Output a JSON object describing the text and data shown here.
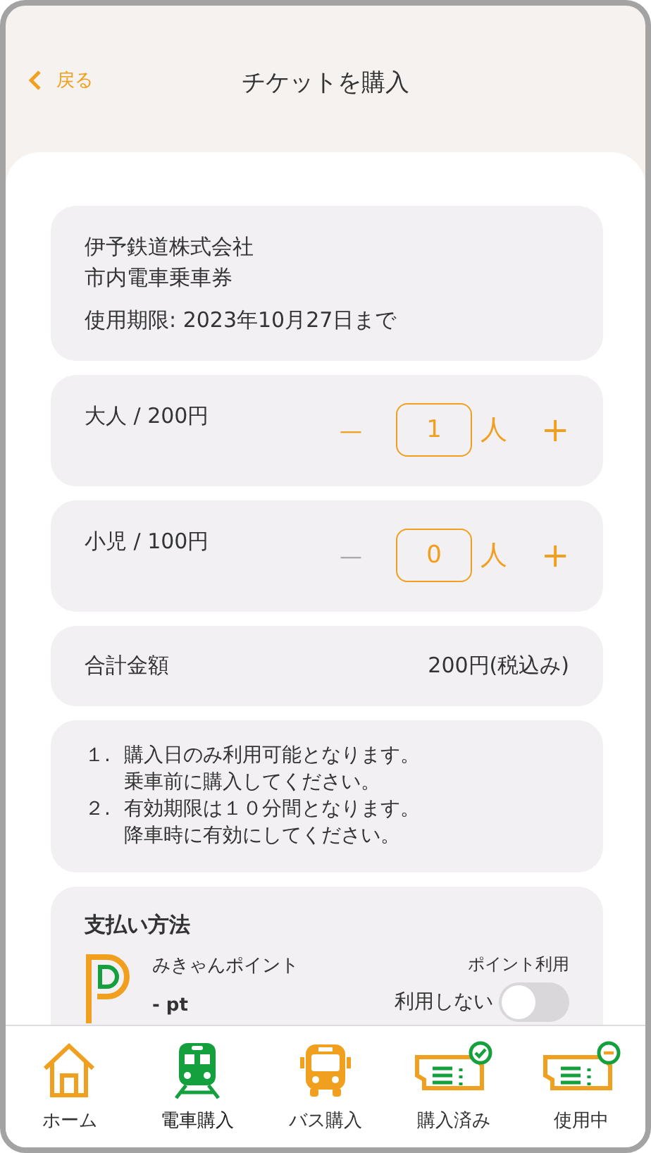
{
  "header": {
    "back": "戻る",
    "title": "チケットを購入"
  },
  "ticket": {
    "company": "伊予鉄道株式会社",
    "name": "市内電車乗車券",
    "expiry": "使用期限: 2023年10月27日まで"
  },
  "counters": [
    {
      "label": "大人 / 200円",
      "value": "1",
      "unit": "人",
      "minus": "—",
      "plus": "+",
      "minus_disabled": false
    },
    {
      "label": "小児 / 100円",
      "value": "0",
      "unit": "人",
      "minus": "—",
      "plus": "+",
      "minus_disabled": true
    }
  ],
  "total": {
    "label": "合計金額",
    "value": "200円(税込み)"
  },
  "notes": [
    {
      "num": "１.",
      "lines": [
        "購入日のみ利用可能となります。",
        "乗車前に購入してください。"
      ]
    },
    {
      "num": "２.",
      "lines": [
        "有効期限は１０分間となります。",
        "降車時に有効にしてください。"
      ]
    }
  ],
  "payment": {
    "title": "支払い方法",
    "point_name": "みきゃんポイント",
    "point_value": "- pt",
    "use_label": "ポイント利用",
    "toggle_label": "利用しない",
    "toggle_on": false
  },
  "nav": [
    {
      "kind": "home",
      "label": "ホーム",
      "selected": false
    },
    {
      "kind": "train",
      "label": "電車購入",
      "selected": true
    },
    {
      "kind": "bus",
      "label": "バス購入",
      "selected": false
    },
    {
      "kind": "purchased",
      "label": "購入済み",
      "selected": false
    },
    {
      "kind": "inuse",
      "label": "使用中",
      "selected": false
    }
  ]
}
